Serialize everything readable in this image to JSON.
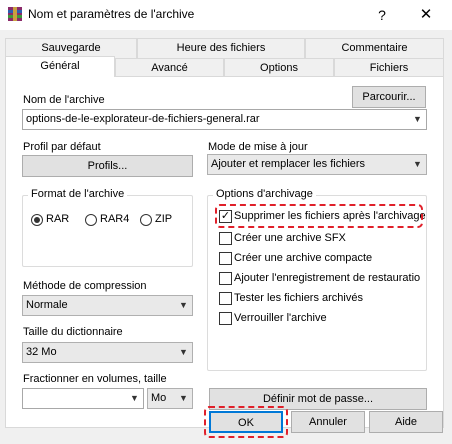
{
  "window": {
    "title": "Nom et paramètres de l'archive",
    "help": "?",
    "close": "✕"
  },
  "tabs_back": [
    "Sauvegarde",
    "Heure des fichiers",
    "Commentaire"
  ],
  "tabs_front": [
    "Général",
    "Avancé",
    "Options",
    "Fichiers"
  ],
  "archive_name": {
    "label": "Nom de l'archive",
    "value": "options-de-le-explorateur-de-fichiers-general.rar",
    "browse": "Parcourir..."
  },
  "profile": {
    "label": "Profil par défaut",
    "button": "Profils..."
  },
  "update_mode": {
    "label": "Mode de mise à jour",
    "value": "Ajouter et remplacer les fichiers"
  },
  "format": {
    "label": "Format de l'archive",
    "options": [
      "RAR",
      "RAR4",
      "ZIP"
    ],
    "selected": "RAR"
  },
  "options": {
    "label": "Options d'archivage",
    "items": [
      {
        "label": "Supprimer les fichiers après l'archivage",
        "checked": true
      },
      {
        "label": "Créer une archive SFX",
        "checked": false
      },
      {
        "label": "Créer une archive compacte",
        "checked": false
      },
      {
        "label": "Ajouter l'enregistrement de restauratio",
        "checked": false
      },
      {
        "label": "Tester les fichiers archivés",
        "checked": false
      },
      {
        "label": "Verrouiller l'archive",
        "checked": false
      }
    ]
  },
  "compression": {
    "label": "Méthode de compression",
    "value": "Normale"
  },
  "dictionary": {
    "label": "Taille du dictionnaire",
    "value": "32 Mo"
  },
  "split": {
    "label": "Fractionner en volumes, taille",
    "value": "",
    "unit": "Mo"
  },
  "password_button": "Définir mot de passe...",
  "footer": {
    "ok": "OK",
    "cancel": "Annuler",
    "help": "Aide"
  },
  "colors": {
    "highlight": "#e0202a",
    "focus": "#0078d7"
  }
}
